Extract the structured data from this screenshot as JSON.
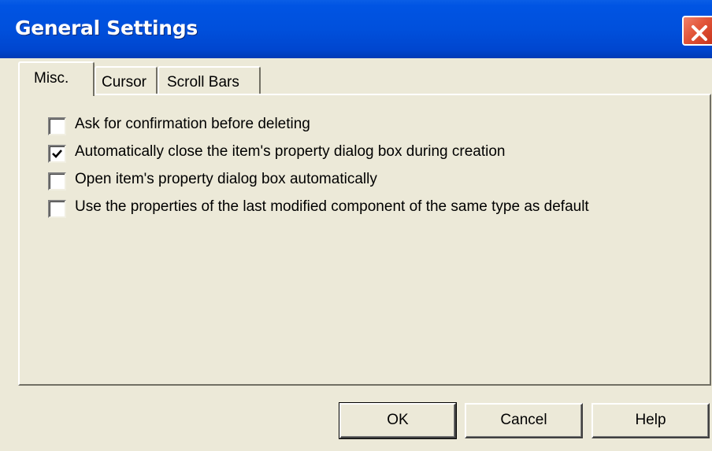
{
  "window": {
    "title": "General Settings",
    "close_icon": "close-icon"
  },
  "tabs": [
    {
      "label": "Misc.",
      "selected": true
    },
    {
      "label": "Cursor",
      "selected": false
    },
    {
      "label": "Scroll Bars",
      "selected": false
    }
  ],
  "options": [
    {
      "label": "Ask for confirmation before deleting",
      "checked": false
    },
    {
      "label": "Automatically close the item's property dialog box during creation",
      "checked": true
    },
    {
      "label": "Open item's property dialog box automatically",
      "checked": false
    },
    {
      "label": "Use the properties of the last modified component of the same type as default",
      "checked": false
    }
  ],
  "buttons": {
    "ok": "OK",
    "cancel": "Cancel",
    "help": "Help"
  },
  "colors": {
    "titlebar": "#0054e3",
    "dialog_face": "#ece9d8",
    "close_button": "#e2563a"
  }
}
